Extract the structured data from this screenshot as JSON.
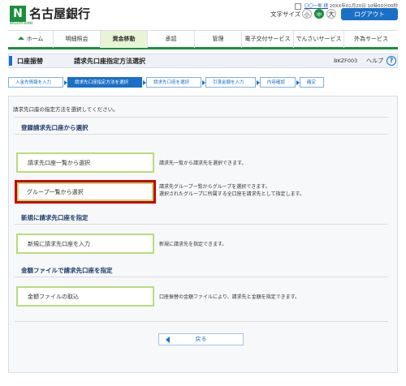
{
  "brand": {
    "logo_mark": "N",
    "logo_sub": "NAGOYA BANK",
    "name": "名古屋銀行",
    "color": "#1a8f3c"
  },
  "user": {
    "name": "〇〇一郎 様",
    "last_login": "20XX年01月20日 10時00分00秒"
  },
  "font_size": {
    "label": "文字サイズ",
    "small": "小",
    "medium": "中",
    "large": "大"
  },
  "logout_label": "ログアウト",
  "nav": [
    {
      "label": "ホーム",
      "icon": "home-icon"
    },
    {
      "label": "明細照会"
    },
    {
      "label": "資金移動",
      "active": true
    },
    {
      "label": "承認"
    },
    {
      "label": "管理"
    },
    {
      "label": "電子交付サービス"
    },
    {
      "label": "でんさいサービス"
    },
    {
      "label": "外為サービス"
    }
  ],
  "title": {
    "category": "口座振替",
    "main": "請求先口座指定方法選択",
    "code": "BKZF003",
    "help": "ヘルプ",
    "help_icon": "?"
  },
  "steps": [
    {
      "label": "入金先情報を入力"
    },
    {
      "label": "請求先口座指定方法を選択",
      "active": true
    },
    {
      "label": "請求先口座を選択"
    },
    {
      "label": "引落金額を入力"
    },
    {
      "label": "内容確認"
    },
    {
      "label": "確定"
    }
  ],
  "instruction": "請求先口座の指定方法を選択してください。",
  "sections": {
    "registered": "登録請求先口座から選択",
    "new": "新規に請求先口座を指定",
    "file": "金額ファイルで請求先口座を指定"
  },
  "options": {
    "list_select": {
      "label": "請求先口座一覧から選択",
      "desc": "請求先一覧から請求先を選択できます。"
    },
    "group_select": {
      "label": "グループ一覧から選択",
      "desc1": "請求先グループ一覧からグループを選択できます。",
      "desc2": "選択されたグループに所属する全口座を請求先として指定します。"
    },
    "new_input": {
      "label": "新規に請求先口座を入力",
      "desc": "新規に請求先を指定できます。"
    },
    "file_import": {
      "label": "金額ファイルの取込",
      "desc": "口座振替の金額ファイルにより、請求先と金額を指定できます。"
    }
  },
  "back_label": "戻る",
  "colors": {
    "primary_blue": "#1a70c6",
    "highlight_red": "#cc0000",
    "option_border": "#b7dd7a"
  }
}
